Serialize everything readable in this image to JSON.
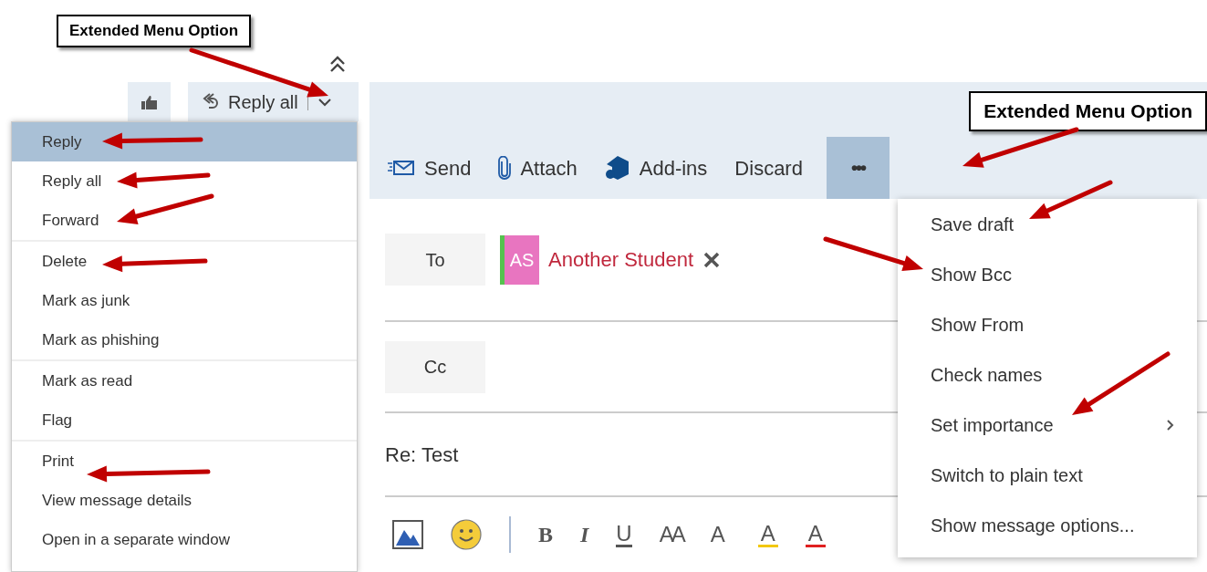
{
  "callouts": [
    {
      "text": "Extended Menu Option"
    },
    {
      "text": "Extended Menu Option"
    }
  ],
  "reading_toolbar": {
    "reply_button": {
      "label": "Reply all"
    }
  },
  "reply_menu": {
    "groups": [
      {
        "items": [
          {
            "label": "Reply",
            "selected": true
          },
          {
            "label": "Reply all",
            "selected": false
          },
          {
            "label": "Forward",
            "selected": false
          }
        ]
      },
      {
        "items": [
          {
            "label": "Delete",
            "selected": false
          },
          {
            "label": "Mark as junk",
            "selected": false
          },
          {
            "label": "Mark as phishing",
            "selected": false
          }
        ]
      },
      {
        "items": [
          {
            "label": "Mark as read",
            "selected": false
          },
          {
            "label": "Flag",
            "selected": false
          }
        ]
      },
      {
        "items": [
          {
            "label": "Print",
            "selected": false
          },
          {
            "label": "View message details",
            "selected": false
          },
          {
            "label": "Open in a separate window",
            "selected": false
          }
        ]
      }
    ]
  },
  "compose_toolbar": {
    "actions": [
      {
        "kind": "send",
        "label": "Send"
      },
      {
        "kind": "attach",
        "label": "Attach"
      },
      {
        "kind": "addins",
        "label": "Add-ins"
      },
      {
        "kind": "discard",
        "label": "Discard"
      }
    ],
    "more_button": {
      "label": "•••",
      "selected": true
    }
  },
  "more_menu": {
    "items": [
      {
        "label": "Save draft",
        "submenu": false
      },
      {
        "label": "Show Bcc",
        "submenu": false
      },
      {
        "label": "Show From",
        "submenu": false
      },
      {
        "label": "Check names",
        "submenu": false
      },
      {
        "label": "Set importance",
        "submenu": true
      },
      {
        "label": "Switch to plain text",
        "submenu": false
      },
      {
        "label": "Show message options...",
        "submenu": false
      }
    ]
  },
  "compose": {
    "to_label": "To",
    "recipients": [
      {
        "initials": "AS",
        "name": "Another Student",
        "color": "#e875c0"
      }
    ],
    "cc_label": "Cc",
    "subject": "Re: Test",
    "format_buttons": [
      {
        "kind": "bold",
        "glyph": "B"
      },
      {
        "kind": "italic",
        "glyph": "I"
      },
      {
        "kind": "underline",
        "glyph": "U"
      },
      {
        "kind": "size",
        "glyph": "AA"
      },
      {
        "kind": "grow",
        "glyph": "A"
      },
      {
        "kind": "highlight",
        "glyph": "A"
      },
      {
        "kind": "color",
        "glyph": "A"
      }
    ]
  }
}
